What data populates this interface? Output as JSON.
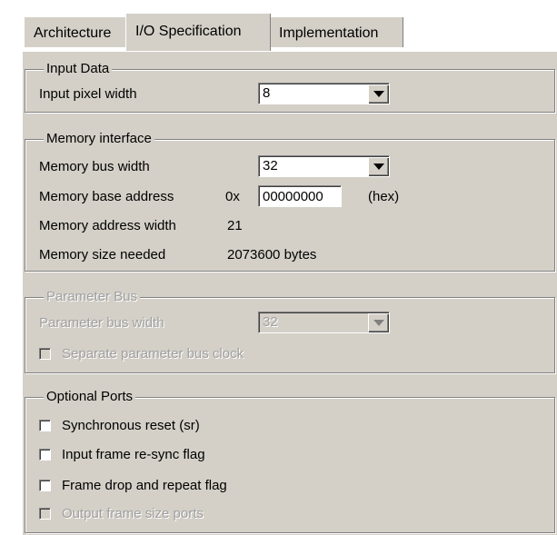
{
  "tabs": [
    {
      "label": "Architecture",
      "active": false
    },
    {
      "label": "I/O Specification",
      "active": true
    },
    {
      "label": "Implementation",
      "active": false
    }
  ],
  "input_data": {
    "legend": "Input Data",
    "pixel_width_label": "Input pixel width",
    "pixel_width_value": "8"
  },
  "memory": {
    "legend": "Memory interface",
    "bus_width_label": "Memory bus width",
    "bus_width_value": "32",
    "base_address_label": "Memory base address",
    "base_address_prefix": "0x",
    "base_address_value": "00000000",
    "base_address_suffix": "(hex)",
    "address_width_label": "Memory address width",
    "address_width_value": "21",
    "size_label": "Memory size needed",
    "size_value": "2073600 bytes"
  },
  "parameter_bus": {
    "legend": "Parameter Bus",
    "bus_width_label": "Parameter bus width",
    "bus_width_value": "32",
    "separate_clock_label": "Separate parameter bus clock"
  },
  "optional_ports": {
    "legend": "Optional Ports",
    "items": [
      {
        "label": "Synchronous reset (sr)",
        "enabled": true,
        "checked": false
      },
      {
        "label": "Input frame re-sync flag",
        "enabled": true,
        "checked": false
      },
      {
        "label": "Frame drop and repeat flag",
        "enabled": true,
        "checked": false
      },
      {
        "label": "Output frame size ports",
        "enabled": false,
        "checked": false
      }
    ]
  },
  "colors": {
    "dialog_bg": "#d4d0c8",
    "disabled_text": "#a0a0a0"
  }
}
